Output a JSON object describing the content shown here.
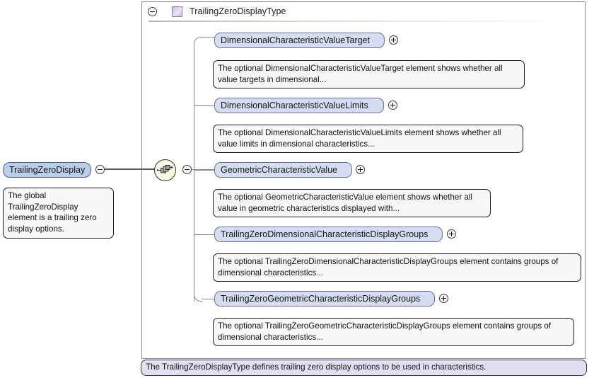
{
  "diagram": {
    "type_title": "TrailingZeroDisplayType",
    "type_icon": "complex-type-icon",
    "collapse_icon": "minus-circle-icon",
    "compositor_icon": "sequence-icon",
    "caption": "The TrailingZeroDisplayType defines trailing zero display options to be used in characteristics."
  },
  "global_element": {
    "label": "TrailingZeroDisplay",
    "toggle_icon": "minus-circle-icon",
    "annotation": "The global TrailingZeroDisplay element is a trailing zero display options."
  },
  "children": [
    {
      "label": "DimensionalCharacteristicValueTarget",
      "toggle_icon": "plus-circle-icon",
      "annotation": "The optional DimensionalCharacteristicValueTarget element shows whether all value targets in dimensional..."
    },
    {
      "label": "DimensionalCharacteristicValueLimits",
      "toggle_icon": "plus-circle-icon",
      "annotation": "The optional DimensionalCharacteristicValueLimits element shows whether all value limits in dimensional characteristics..."
    },
    {
      "label": "GeometricCharacteristicValue",
      "toggle_icon": "plus-circle-icon",
      "annotation": "The optional GeometricCharacteristicValue element shows whether all value in geometric characteristics displayed with..."
    },
    {
      "label": "TrailingZeroDimensionalCharacteristicDisplayGroups",
      "toggle_icon": "plus-circle-icon",
      "annotation": "The optional TrailingZeroDimensionalCharacteristicDisplayGroups element contains groups of dimensional characteristics..."
    },
    {
      "label": "TrailingZeroGeometricCharacteristicDisplayGroups",
      "toggle_icon": "plus-circle-icon",
      "annotation": "The optional TrailingZeroGeometricCharacteristicDisplayGroups element contains groups of dimensional characteristics..."
    }
  ],
  "colors": {
    "node_fill": "#d6dcf2",
    "global_fill": "#b9cfeb",
    "bubble_fill": "#f7f7f7",
    "caption_fill": "#e4dff0",
    "type_glyph": "#c9b4e4",
    "compositor_fill": "#fbfbe6",
    "line": "#8a8a8a"
  }
}
